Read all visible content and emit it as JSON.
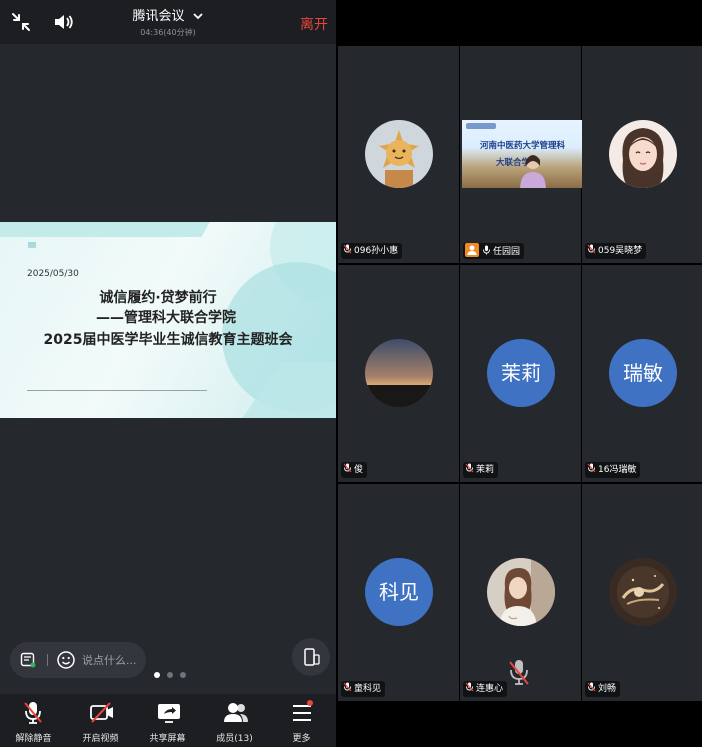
{
  "header": {
    "title": "腾讯会议",
    "elapsed": "04:36(40分钟)",
    "leave_label": "离开"
  },
  "slide": {
    "date": "2025/05/30",
    "line1": "诚信履约·贷梦前行",
    "line2": "——管理科大联合学院",
    "line3": "2025届中医学毕业生诚信教育主题班会"
  },
  "comment": {
    "placeholder": "说点什么..."
  },
  "pager": {
    "count": 3,
    "active": 0
  },
  "toolbar": {
    "unmute_label": "解除静音",
    "video_label": "开启视频",
    "share_label": "共享屏幕",
    "members_label": "成员(13)",
    "more_label": "更多"
  },
  "participants": [
    {
      "name": "096孙小惠",
      "avatar": "sun-plush-photo"
    },
    {
      "name": "任园园",
      "avatar": "video-feed",
      "host": true,
      "banner_line1": "河南中医药大学管理科",
      "banner_line2": "大联合学"
    },
    {
      "name": "059吴晓梦",
      "avatar": "girl-illustration"
    },
    {
      "name": "俊",
      "avatar": "sunset-photo"
    },
    {
      "name": "茉莉",
      "avatar_text": "茉莉"
    },
    {
      "name": "16冯瑞敏",
      "avatar_text": "瑞敏"
    },
    {
      "name": "童科见",
      "avatar_text": "科见"
    },
    {
      "name": "连惠心",
      "avatar": "woman-photo"
    },
    {
      "name": "刘畅",
      "avatar": "dark-art-photo"
    }
  ],
  "colors": {
    "leave": "#e8453c",
    "avatar_blue": "#3f72c3",
    "panel": "#25282d",
    "bar": "#1c1e22"
  }
}
